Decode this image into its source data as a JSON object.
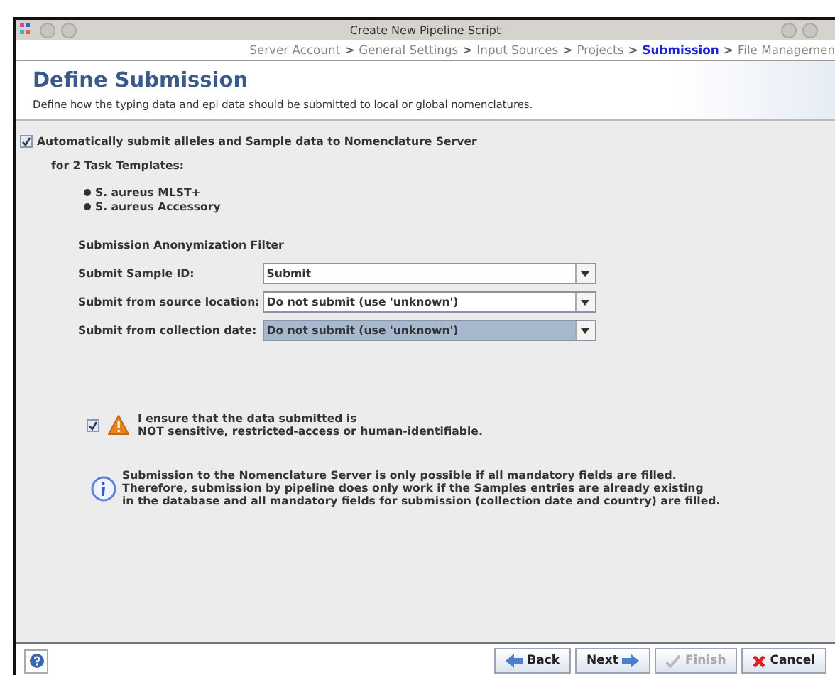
{
  "window": {
    "title": "Create New Pipeline Script"
  },
  "breadcrumb": [
    {
      "label": "Server Account",
      "selected": false
    },
    {
      "label": "General Settings",
      "selected": false
    },
    {
      "label": "Input Sources",
      "selected": false
    },
    {
      "label": "Projects",
      "selected": false
    },
    {
      "label": "Submission",
      "selected": true
    },
    {
      "label": "File Managemen",
      "selected": false
    }
  ],
  "breadcrumb_separator": ">",
  "header": {
    "title": "Define Submission",
    "description": "Define how the typing data and epi data should be submitted to local or global nomenclatures."
  },
  "auto_submit": {
    "label": "Automatically submit alleles and Sample data to Nomenclature Server",
    "checked": true
  },
  "templates_label": "for 2 Task Templates:",
  "templates": [
    "S. aureus MLST+",
    "S. aureus Accessory"
  ],
  "filter": {
    "title": "Submission Anonymization Filter",
    "rows": [
      {
        "label": "Submit Sample ID:",
        "value": "Submit",
        "selected": false
      },
      {
        "label": "Submit from source location:",
        "value": "Do not submit (use 'unknown')",
        "selected": false
      },
      {
        "label": "Submit from collection date:",
        "value": "Do not submit (use 'unknown')",
        "selected": true
      }
    ]
  },
  "confirm": {
    "checked": true,
    "lines": [
      "I ensure that the data submitted is",
      "NOT sensitive, restricted-access or human-identifiable."
    ]
  },
  "info": [
    "Submission to the Nomenclature Server is only possible if all mandatory fields are filled.",
    "Therefore, submission by pipeline does only work if the Samples entries are already existing",
    "in the database and all mandatory fields for submission (collection date and country) are filled."
  ],
  "buttons": [
    {
      "kind": "back",
      "label": "Back",
      "disabled": false
    },
    {
      "kind": "next",
      "label": "Next",
      "disabled": false
    },
    {
      "kind": "finish",
      "label": "Finish",
      "disabled": true
    },
    {
      "kind": "cancel",
      "label": "Cancel",
      "disabled": false
    }
  ]
}
